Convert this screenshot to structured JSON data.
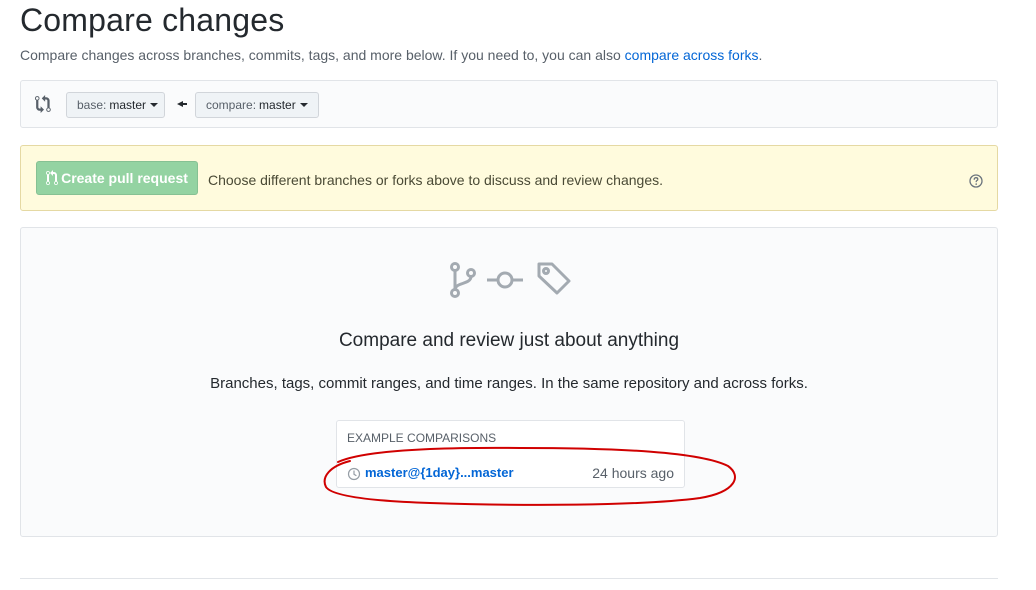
{
  "page": {
    "title": "Compare changes",
    "subtitle_text": "Compare changes across branches, commits, tags, and more below. If you need to, you can also ",
    "subtitle_link": "compare across forks",
    "subtitle_end": "."
  },
  "range": {
    "base_label": "base:",
    "base_value": "master",
    "compare_label": "compare:",
    "compare_value": "master"
  },
  "flash": {
    "button_label": "Create pull request",
    "message": "Choose different branches or forks above to discuss and review changes."
  },
  "blankslate": {
    "title": "Compare and review just about anything",
    "description": "Branches, tags, commit ranges, and time ranges. In the same repository and across forks.",
    "examples_header": "EXAMPLE COMPARISONS",
    "examples": [
      {
        "label": "master@{1day}...master",
        "time": "24 hours ago"
      }
    ]
  },
  "colors": {
    "link": "#0366d6",
    "flash_bg": "#fffbdd",
    "button_disabled": "#94d3a2",
    "annotation": "#d00000"
  },
  "icons": [
    "git-compare-icon",
    "arrow-left-icon",
    "git-pull-request-icon",
    "question-icon",
    "git-branch-icon",
    "git-commit-icon",
    "tag-icon",
    "history-icon"
  ]
}
